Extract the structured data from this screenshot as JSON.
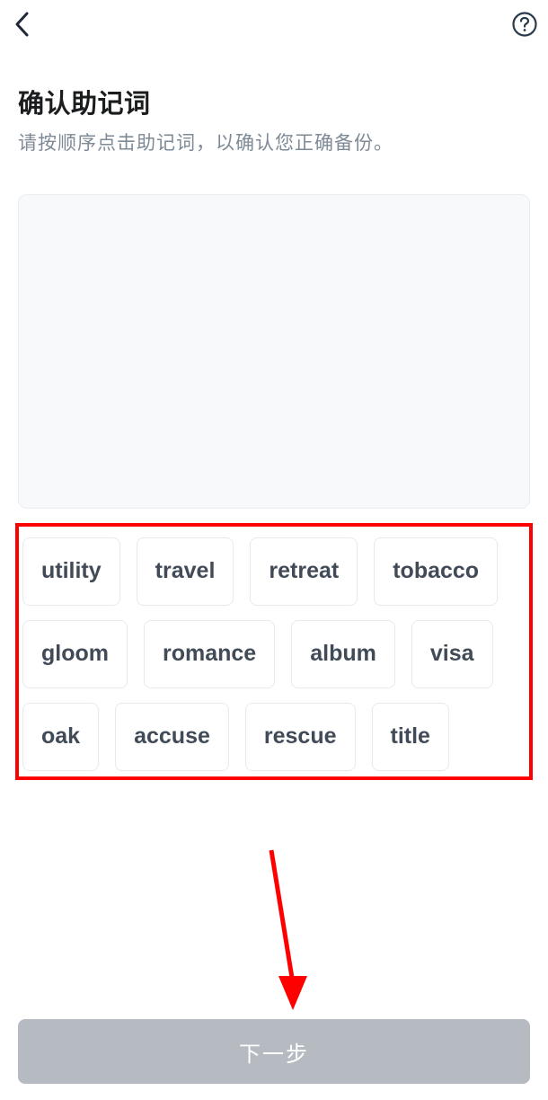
{
  "header": {
    "title": "确认助记词",
    "subtitle": "请按顺序点击助记词，以确认您正确备份。"
  },
  "words": [
    "utility",
    "travel",
    "retreat",
    "tobacco",
    "gloom",
    "romance",
    "album",
    "visa",
    "oak",
    "accuse",
    "rescue",
    "title"
  ],
  "nextButton": {
    "label": "下一步"
  },
  "colors": {
    "highlight": "#ff0000",
    "primaryText": "#1a1c1e",
    "secondaryText": "#7e8a96",
    "chipText": "#414b57",
    "chipBorder": "#e6eaef",
    "disabledButton": "#b6bbc1"
  }
}
